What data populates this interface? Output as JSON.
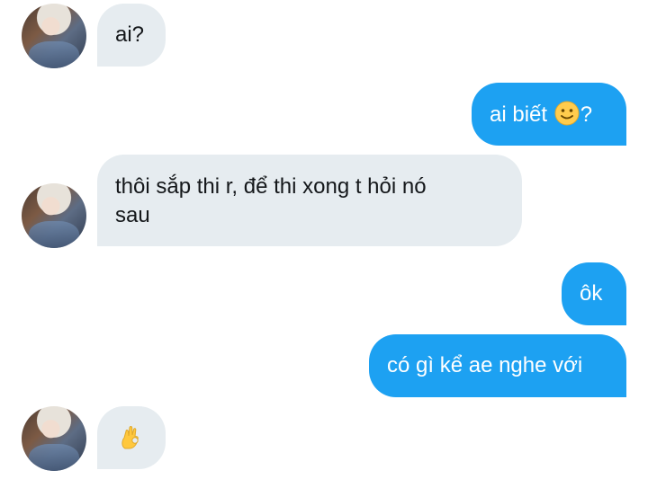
{
  "messages": [
    {
      "id": "m1",
      "direction": "incoming",
      "text": "ai?"
    },
    {
      "id": "m2",
      "direction": "outgoing",
      "text_before": "ai biết ",
      "emoji_icon": "slightly-smiling-face-icon",
      "text_after": "?"
    },
    {
      "id": "m3",
      "direction": "incoming",
      "lines": [
        "thôi sắp thi r, để thi xong t hỏi nó",
        "sau"
      ]
    },
    {
      "id": "m4",
      "direction": "outgoing",
      "text": "ôk"
    },
    {
      "id": "m5",
      "direction": "outgoing",
      "text": "có gì kể ae nghe với"
    },
    {
      "id": "m6",
      "direction": "incoming",
      "emoji_icon": "ok-hand-icon"
    }
  ],
  "colors": {
    "incoming_bubble": "#e6ecf0",
    "outgoing_bubble": "#1da1f2",
    "incoming_text": "#14171a",
    "outgoing_text": "#ffffff"
  }
}
